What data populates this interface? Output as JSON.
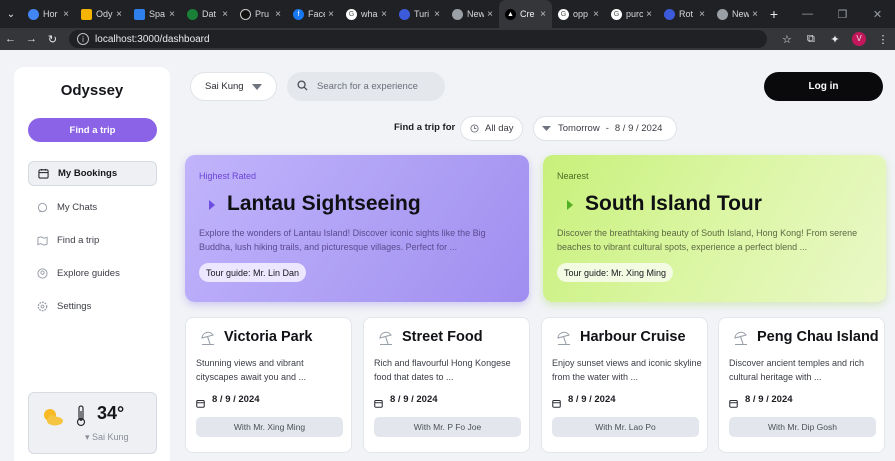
{
  "browser": {
    "tabs": [
      {
        "title": "Hor",
        "color": "#4285f4"
      },
      {
        "title": "Ody",
        "color": "#f4b400"
      },
      {
        "title": "Spa",
        "color": "#2f80ed"
      },
      {
        "title": "Dat",
        "color": "#1a7f37"
      },
      {
        "title": "Pru",
        "color": "#111111"
      },
      {
        "title": "Face",
        "color": "#1877f2"
      },
      {
        "title": "wha",
        "color": "#6b6b6b"
      },
      {
        "title": "Turi",
        "color": "#3b5bdb"
      },
      {
        "title": "New",
        "color": "#6b6b6b"
      },
      {
        "title": "Cre",
        "color": "#000000",
        "active": true
      },
      {
        "title": "opp",
        "color": "#6b6b6b"
      },
      {
        "title": "purc",
        "color": "#6b6b6b"
      },
      {
        "title": "Rot",
        "color": "#3b5bdb"
      },
      {
        "title": "New",
        "color": "#6b6b6b"
      }
    ],
    "url": "localhost:3000/dashboard",
    "avatar_letter": "V"
  },
  "sidebar": {
    "brand": "Odyssey",
    "cta": "Find a trip",
    "items": [
      {
        "label": "My Bookings",
        "icon": "calendar-icon",
        "active": true
      },
      {
        "label": "My Chats",
        "icon": "chat-icon"
      },
      {
        "label": "Find a trip",
        "icon": "map-icon"
      },
      {
        "label": "Explore guides",
        "icon": "people-icon"
      },
      {
        "label": "Settings",
        "icon": "gear-icon"
      }
    ],
    "weather": {
      "temp": "34°",
      "location": "Sai Kung",
      "icon": "partly-sunny-icon"
    }
  },
  "topbar": {
    "location": "Sai Kung",
    "search_placeholder": "Search for a experience",
    "login": "Log in"
  },
  "filters": {
    "label": "Find a trip for",
    "time": "All day",
    "day": "Tomorrow",
    "separator": "-",
    "date": "8 / 9 / 2024"
  },
  "featured": [
    {
      "kicker": "Highest Rated",
      "title": "Lantau Sightseeing",
      "desc": "Explore the wonders of Lantau Island! Discover iconic sights like the Big Buddha, lush hiking trails, and picturesque villages. Perfect for ...",
      "guide": "Tour guide: Mr. Lin Dan"
    },
    {
      "kicker": "Nearest",
      "title": "South Island Tour",
      "desc": "Discover the breathtaking beauty of South Island, Hong Kong! From serene beaches to vibrant cultural spots, experience a perfect blend ...",
      "guide": "Tour guide: Mr. Xing Ming"
    }
  ],
  "tours": [
    {
      "name": "Victoria Park",
      "desc": "Stunning views and vibrant cityscapes await you and ...",
      "date": "8 / 9 / 2024",
      "with": "With Mr. Xing Ming"
    },
    {
      "name": "Street Food",
      "desc": "Rich and flavourful Hong Kongese food that dates to ...",
      "date": "8 / 9 / 2024",
      "with": "With Mr. P Fo Joe"
    },
    {
      "name": "Harbour Cruise",
      "desc": "Enjoy sunset views and iconic skyline from the water with ...",
      "date": "8 / 9 / 2024",
      "with": "With Mr. Lao Po"
    },
    {
      "name": "Peng Chau Island",
      "desc": "Discover ancient temples and rich cultural heritage with ...",
      "date": "8 / 9 / 2024",
      "with": "With Mr. Dip Gosh"
    }
  ]
}
